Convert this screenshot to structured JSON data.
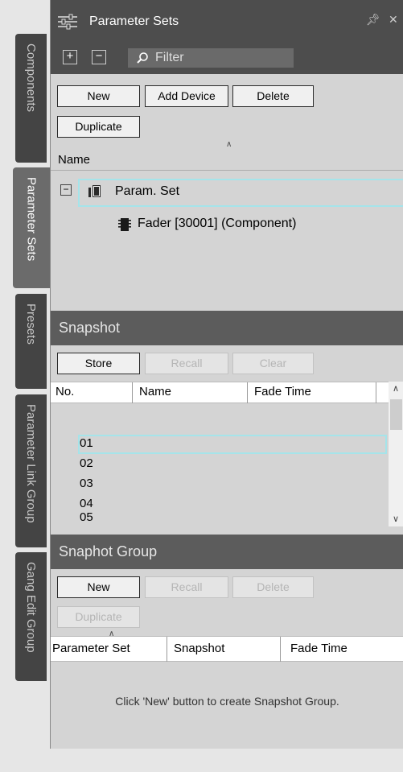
{
  "side_tabs": [
    {
      "label": "Components",
      "active": false
    },
    {
      "label": "Parameter Sets",
      "active": true
    },
    {
      "label": "Presets",
      "active": false
    },
    {
      "label": "Parameter Link Group",
      "active": false
    },
    {
      "label": "Gang Edit Group",
      "active": false
    }
  ],
  "title": "Parameter Sets",
  "filter_placeholder": "Filter",
  "buttons": {
    "new": "New",
    "add_device": "Add Device",
    "delete": "Delete",
    "duplicate": "Duplicate"
  },
  "tree": {
    "column": "Name",
    "items": [
      {
        "label": "Param. Set",
        "expanded": true
      },
      {
        "label": "Fader [30001] (Component)"
      }
    ]
  },
  "snapshot": {
    "title": "Snapshot",
    "buttons": {
      "store": "Store",
      "recall": "Recall",
      "clear": "Clear"
    },
    "columns": [
      "No.",
      "Name",
      "Fade Time"
    ],
    "rows": [
      "01",
      "02",
      "03",
      "04",
      "05"
    ],
    "selected_row": "01"
  },
  "snapshot_group": {
    "title": "Snaphot Group",
    "buttons": {
      "new": "New",
      "recall": "Recall",
      "delete": "Delete",
      "duplicate": "Duplicate"
    },
    "columns": [
      "Parameter Set",
      "Snapshot",
      "Fade Time"
    ],
    "empty_message": "Click 'New' button to create Snapshot Group."
  },
  "colors": {
    "title_bg": "#4d4d4d",
    "section_bg": "#5c5c5c",
    "panel_bg": "#d4d4d4",
    "selection_border": "#a5e4ea",
    "active_tab": "#6b6b6b",
    "inactive_tab": "#444444"
  }
}
